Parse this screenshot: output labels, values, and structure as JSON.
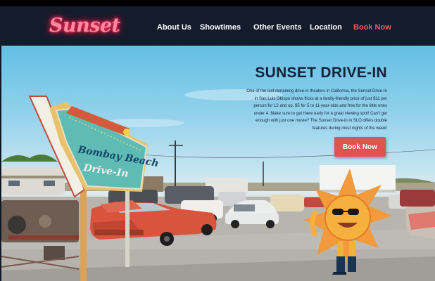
{
  "brand": {
    "logo_text": "Sunset"
  },
  "nav": {
    "items": [
      {
        "label": "About Us"
      },
      {
        "label": "Showtimes"
      },
      {
        "label": "Other Events"
      },
      {
        "label": "Location"
      }
    ],
    "book_label": "Book Now"
  },
  "hero": {
    "title": "SUNSET DRIVE-IN",
    "description": "One of the last remaining drive-in theaters in California, the Sunset Drive-In in San Luis Obispo shows flicks at a family-friendly price of just $11 per person for 12 and up, $5 for 5 to 11-year-olds and free for the little ones under 4. Make sure to get there early for a great viewing spot! Can't get enough with just one movie? The Sunset Drive-in in SLO offers double features during most nights of the week!",
    "cta_label": "Book Now",
    "sign_line1": "Bombay Beach",
    "sign_line2": "Drive-In"
  },
  "colors": {
    "navbar_bg": "#141c2b",
    "logo_neon": "#ff2d5a",
    "accent": "#e15252",
    "title_text": "#16223a",
    "sign_teal": "#5fbcb4",
    "sun_orange": "#f39a3c"
  },
  "icons": [
    "sun-mascot-icon",
    "drive-in-sign-illustration"
  ]
}
